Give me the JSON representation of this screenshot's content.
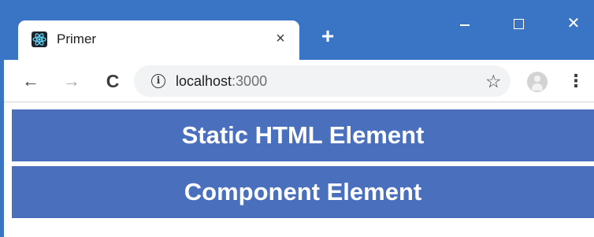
{
  "browser": {
    "tab": {
      "title": "Primer",
      "close_glyph": "×",
      "favicon": "react-logo-icon"
    },
    "new_tab_glyph": "+",
    "window_controls": {
      "close_glyph": "✕"
    },
    "toolbar": {
      "back_glyph": "←",
      "forward_glyph": "→",
      "reload_glyph": "C",
      "info_glyph": "i",
      "url_host": "localhost",
      "url_port": ":3000",
      "star_glyph": "☆",
      "menu_glyph": "⋮"
    },
    "colors": {
      "frame": "#3a74c4",
      "banner": "#4a6fbd"
    }
  },
  "page": {
    "elements": [
      {
        "text": "Static HTML Element"
      },
      {
        "text": "Component Element"
      }
    ]
  }
}
